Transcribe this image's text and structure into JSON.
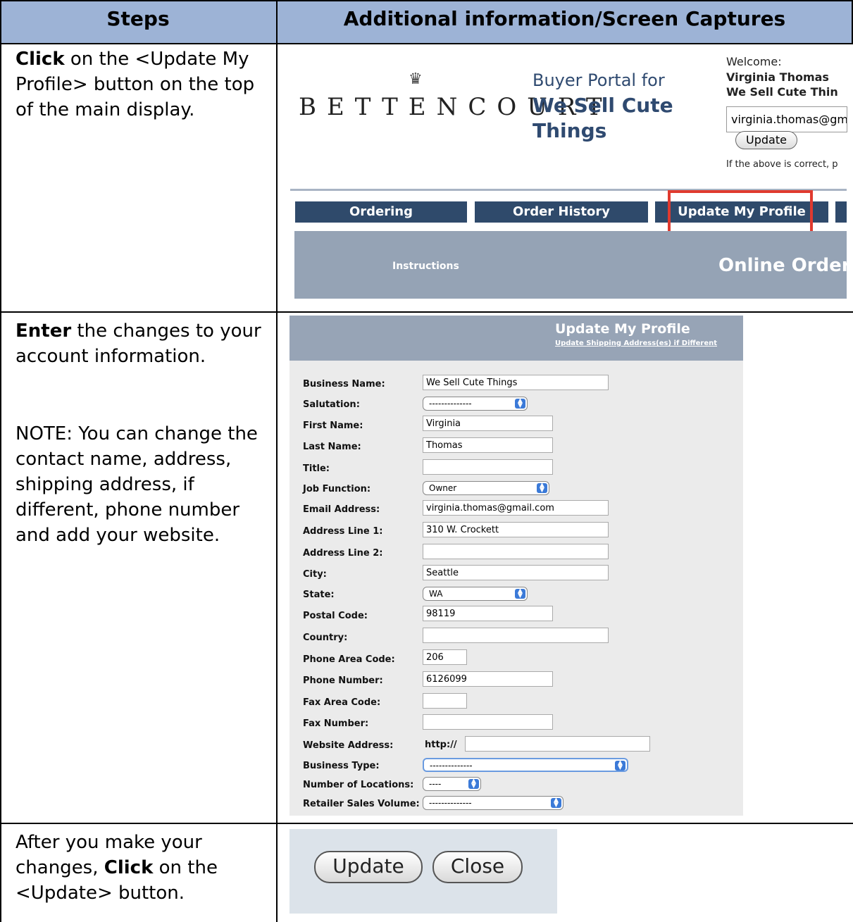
{
  "header": {
    "steps": "Steps",
    "info": "Additional information/Screen Captures"
  },
  "row1": {
    "step_bold": "Click",
    "step_rest": " on the <Update My Profile> button on the top of the main display.",
    "logo": "BETTENCOURT",
    "portal_line1": "Buyer Portal for",
    "portal_line2": "We Sell Cute Things",
    "welcome": "Welcome:",
    "welcome_name": "Virginia  Thomas",
    "welcome_company": "We Sell Cute Thin",
    "email": "virginia.thomas@gm",
    "update_btn": "Update",
    "small_note": "If the above is correct, p",
    "tabs": [
      "Ordering",
      "Order History",
      "Update My Profile"
    ],
    "instructions": "Instructions",
    "online_order": "Online Order",
    "highlight_color": "#e03a2f"
  },
  "row2": {
    "step_bold": "Enter",
    "step_rest": " the changes to your account information.",
    "note": "NOTE: You can change the contact name, address, shipping address, if different, phone number and add your website.",
    "form_title": "Update My Profile",
    "form_link": "Update Shipping Address(es) if Different",
    "fields": {
      "business_name": {
        "label": "Business Name:",
        "value": "We Sell Cute Things"
      },
      "salutation": {
        "label": "Salutation:",
        "value": "--------------"
      },
      "first_name": {
        "label": "First Name:",
        "value": "Virginia"
      },
      "last_name": {
        "label": "Last Name:",
        "value": "Thomas"
      },
      "title": {
        "label": "Title:",
        "value": ""
      },
      "job_function": {
        "label": "Job Function:",
        "value": "Owner"
      },
      "email": {
        "label": "Email Address:",
        "value": "virginia.thomas@gmail.com"
      },
      "address1": {
        "label": "Address Line 1:",
        "value": "310 W. Crockett"
      },
      "address2": {
        "label": "Address Line 2:",
        "value": ""
      },
      "city": {
        "label": "City:",
        "value": "Seattle"
      },
      "state": {
        "label": "State:",
        "value": "WA"
      },
      "postal": {
        "label": "Postal Code:",
        "value": "98119"
      },
      "country": {
        "label": "Country:",
        "value": ""
      },
      "phone_area": {
        "label": "Phone Area Code:",
        "value": "206"
      },
      "phone": {
        "label": "Phone Number:",
        "value": "6126099"
      },
      "fax_area": {
        "label": "Fax Area Code:",
        "value": ""
      },
      "fax": {
        "label": "Fax Number:",
        "value": ""
      },
      "website": {
        "label": "Website Address:",
        "prefix": "http://",
        "value": ""
      },
      "business_type": {
        "label": "Business Type:",
        "value": "--------------"
      },
      "locations": {
        "label": "Number of Locations:",
        "value": "----"
      },
      "sales_volume": {
        "label": "Retailer Sales Volume:",
        "value": "--------------"
      }
    }
  },
  "row3": {
    "step_pre": "After you make your changes, ",
    "step_bold": "Click",
    "step_rest": " on the <Update> button.",
    "update": "Update",
    "close": "Close"
  }
}
